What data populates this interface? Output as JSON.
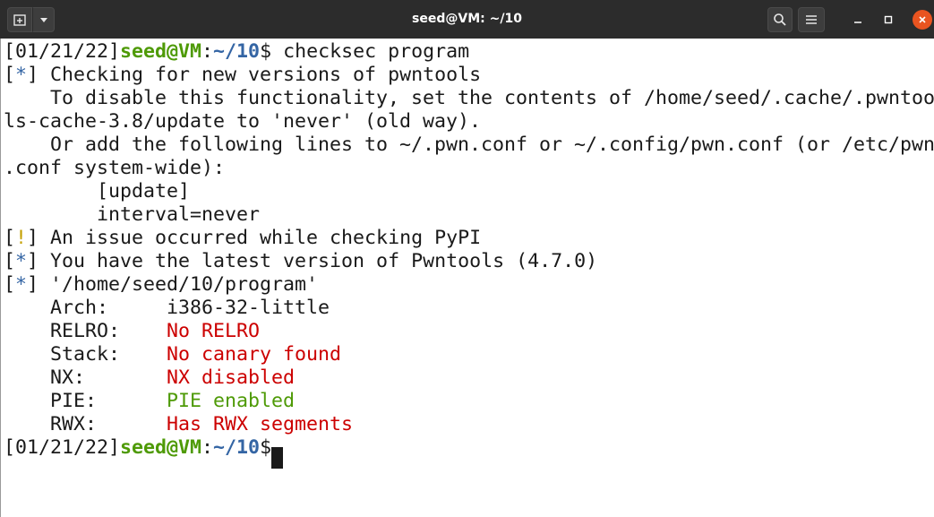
{
  "window": {
    "title": "seed@VM: ~/10",
    "icons": {
      "new_tab": "new-tab-icon",
      "tab_menu": "chevron-down-icon",
      "search": "search-icon",
      "menu": "hamburger-menu-icon",
      "minimize": "minimize-icon",
      "maximize": "maximize-icon",
      "close": "close-icon"
    },
    "close_color": "#e95420"
  },
  "colors": {
    "background": "#ffffff",
    "text": "#1a1a1a",
    "prompt_user": "#4e9a06",
    "prompt_path": "#3465a4",
    "info_star": "#3465a4",
    "warn_bang": "#c4a000",
    "bad": "#cc0000",
    "good": "#4e9a06"
  },
  "terminal": {
    "prompt1": {
      "date": "[01/21/22]",
      "user": "seed@VM",
      "colon": ":",
      "path": "~/10",
      "dollar": "$ ",
      "command": "checksec program"
    },
    "l2": {
      "open": "[",
      "mark": "*",
      "close": "]",
      "text": " Checking for new versions of pwntools"
    },
    "l3": "    To disable this functionality, set the contents of /home/seed/.cache/.pwntoo",
    "l4": "ls-cache-3.8/update to 'never' (old way).",
    "l5": "    Or add the following lines to ~/.pwn.conf or ~/.config/pwn.conf (or /etc/pwn",
    "l6": ".conf system-wide):",
    "l7": "        [update]",
    "l8": "        interval=never",
    "l9": {
      "open": "[",
      "mark": "!",
      "close": "]",
      "text": " An issue occurred while checking PyPI"
    },
    "l10": {
      "open": "[",
      "mark": "*",
      "close": "]",
      "text": " You have the latest version of Pwntools (4.7.0)"
    },
    "l11": {
      "open": "[",
      "mark": "*",
      "close": "]",
      "text": " '/home/seed/10/program'"
    },
    "checksec": [
      {
        "label": "    Arch:     ",
        "value": "i386-32-little"
      },
      {
        "label": "    RELRO:    ",
        "value": "No RELRO"
      },
      {
        "label": "    Stack:    ",
        "value": "No canary found"
      },
      {
        "label": "    NX:       ",
        "value": "NX disabled"
      },
      {
        "label": "    PIE:      ",
        "value": "PIE enabled"
      },
      {
        "label": "    RWX:      ",
        "value": "Has RWX segments"
      }
    ],
    "prompt2": {
      "date": "[01/21/22]",
      "user": "seed@VM",
      "colon": ":",
      "path": "~/10",
      "dollar": "$"
    }
  }
}
